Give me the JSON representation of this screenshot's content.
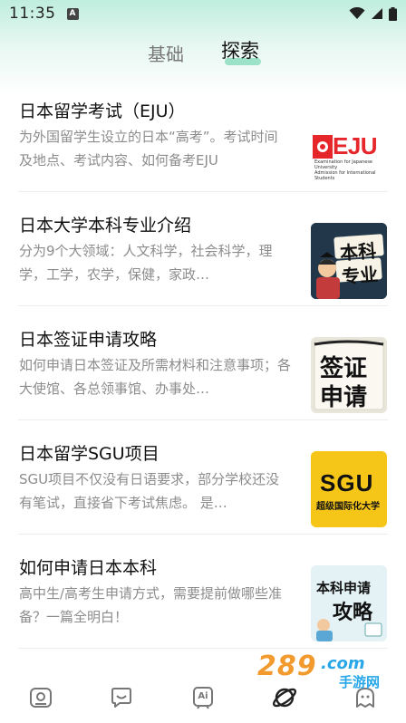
{
  "status_bar": {
    "time": "11:35",
    "badge_letter": "A"
  },
  "tabs": [
    {
      "label": "基础",
      "active": false
    },
    {
      "label": "探索",
      "active": true
    }
  ],
  "articles": [
    {
      "title": "日本留学考试（EJU）",
      "description": "为外国留学生设立的日本“高考”。考试时间及地点、考试内容、如何备考EJU",
      "thumb": {
        "logo": "EJU",
        "sub_line1": "Examination for Japanese University",
        "sub_line2": "Admission for International Students"
      }
    },
    {
      "title": "日本大学本科专业介绍",
      "description": "分为9个大领域：人文科学，社会科学，理学，工学，农学，保健，家政…",
      "thumb": {
        "line1": "本科",
        "line2": "专业"
      }
    },
    {
      "title": "日本签证申请攻略",
      "description": "如何申请日本签证及所需材料和注意事项；各大使馆、各总领事馆、办事处…",
      "thumb": {
        "line1": "签证",
        "line2": "申请"
      }
    },
    {
      "title": "日本留学SGU项目",
      "description": "SGU项目不仅没有日语要求，部分学校还没有笔试，直接省下考试焦虑。 是…",
      "thumb": {
        "line1": "SGU",
        "line2": "超级国际化大学"
      }
    },
    {
      "title": "如何申请日本本科",
      "description": "高中生/高考生申请方式，需要提前做哪些准备？一篇全明白！",
      "thumb": {
        "line1": "本科申请",
        "line2": "攻略"
      }
    }
  ],
  "bottom_nav": [
    {
      "icon": "photo-card-icon"
    },
    {
      "icon": "chat-bubble-icon"
    },
    {
      "icon": "ai-icon",
      "label": "Ai"
    },
    {
      "icon": "planet-icon",
      "active": true
    },
    {
      "icon": "ghost-icon"
    }
  ],
  "watermark": {
    "number": "289",
    "domain": ".com",
    "site": "手游网"
  },
  "colors": {
    "accent": "#9ce2c9",
    "eju_red": "#e5262b",
    "sgu_yellow": "#f5c518"
  }
}
